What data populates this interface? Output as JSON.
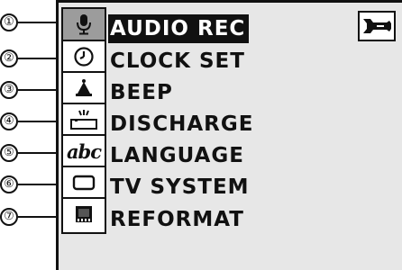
{
  "callouts": [
    "①",
    "②",
    "③",
    "④",
    "⑤",
    "⑥",
    "⑦"
  ],
  "menu": {
    "items": [
      {
        "label": "AUDIO REC",
        "icon": "microphone-icon",
        "selected": true
      },
      {
        "label": "CLOCK SET",
        "icon": "clock-icon",
        "selected": false
      },
      {
        "label": "BEEP",
        "icon": "bell-icon",
        "selected": false
      },
      {
        "label": "DISCHARGE",
        "icon": "battery-discharge-icon",
        "selected": false
      },
      {
        "label": "LANGUAGE",
        "icon": "language-icon",
        "selected": false,
        "icon_text": "abc"
      },
      {
        "label": "TV SYSTEM",
        "icon": "tv-screen-icon",
        "selected": false
      },
      {
        "label": "REFORMAT",
        "icon": "memory-card-icon",
        "selected": false
      }
    ]
  },
  "setup_icon": "wrench-icon",
  "colors": {
    "lcd_background": "#e7e7e7",
    "highlight": "#111111",
    "selected_icon_background": "#9c9c9c"
  }
}
